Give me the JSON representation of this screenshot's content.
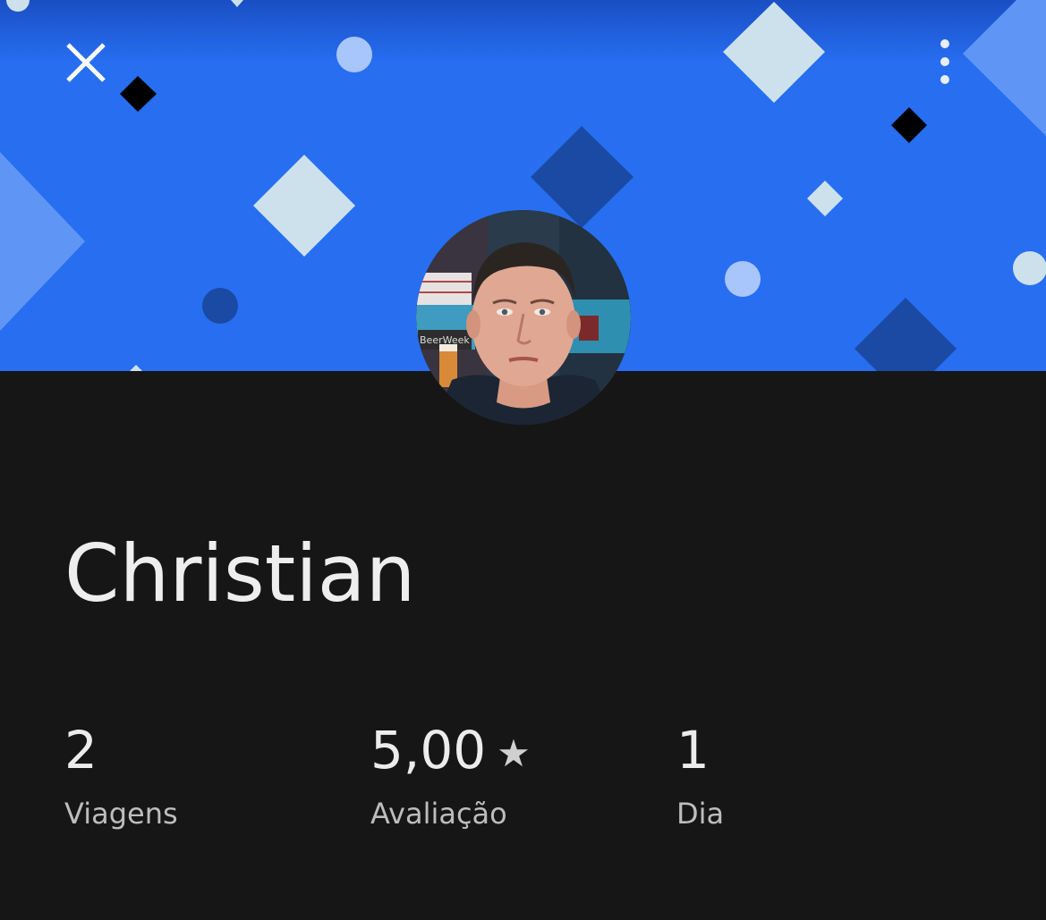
{
  "profile": {
    "name": "Christian"
  },
  "header": {
    "close_icon": "close-icon",
    "more_icon": "more-vertical-icon",
    "accent_color": "#276ef1"
  },
  "stats": {
    "trips": {
      "value": "2",
      "label": "Viagens"
    },
    "rating": {
      "value": "5,00",
      "icon": "star-icon",
      "label": "Avaliação"
    },
    "days": {
      "value": "1",
      "label": "Dia"
    }
  },
  "colors": {
    "header_background": "#276ef1",
    "page_background": "#161616",
    "primary_text": "#eeeeee",
    "secondary_text": "#bdbdbd"
  }
}
